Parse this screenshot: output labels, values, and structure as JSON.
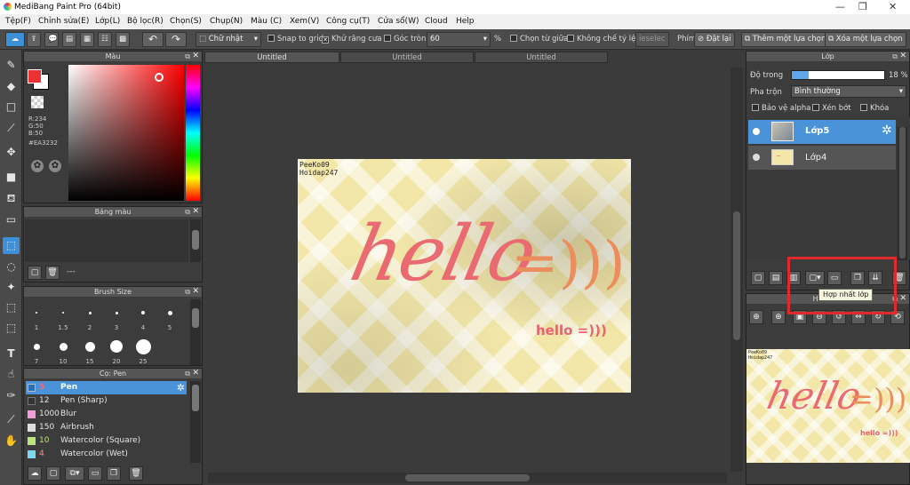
{
  "window": {
    "title": "MediBang Paint Pro (64bit)"
  },
  "menu": [
    "Tệp(F)",
    "Chỉnh sửa(E)",
    "Lớp(L)",
    "Bộ lọc(R)",
    "Chọn(S)",
    "Chụp(N)",
    "Màu (C)",
    "Xem(V)",
    "Công cụ(T)",
    "Cửa sổ(W)",
    "Cloud",
    "Help"
  ],
  "toolbar": {
    "shape": "Chữ nhật",
    "snap_to_grid": "Snap to grid",
    "antialias": "Khử răng cưa",
    "round_corner": "Góc tròn",
    "round_value": "60",
    "percent": "%",
    "select_center": "Chọn từ giữa",
    "no_ratio": "Không chế tỷ lệ",
    "ratio_value": "ieselec",
    "shortcut": "Phím",
    "reset": "Đặt lại",
    "add_selection": "Thêm một lựa chọn",
    "remove_selection": "Xóa một lựa chọn"
  },
  "color_panel": {
    "title": "Màu",
    "r": "R:234",
    "g": "G:50",
    "b": "B:50",
    "hex": "#EA3232",
    "primary": "#EA3232"
  },
  "palette_panel": {
    "title": "Bảng màu",
    "footer": "---"
  },
  "brush_size_panel": {
    "title": "Brush Size",
    "labels_row1": [
      "1",
      "1.5",
      "2",
      "3",
      "4",
      "5"
    ],
    "labels_row2": [
      "7",
      "10",
      "15",
      "20",
      "25"
    ]
  },
  "pen_panel": {
    "title": "Cọ: Pen",
    "items": [
      {
        "size": "5",
        "name": "Pen",
        "color": "#2d6fb0"
      },
      {
        "size": "12",
        "name": "Pen (Sharp)",
        "color": "#333333"
      },
      {
        "size": "1000",
        "name": "Blur",
        "color": "#f39ed9"
      },
      {
        "size": "150",
        "name": "Airbrush",
        "color": "#dddddd"
      },
      {
        "size": "10",
        "name": "Watercolor (Square)",
        "color": "#b9e57a"
      },
      {
        "size": "4",
        "name": "Watercolor (Wet)",
        "color": "#7fd6f0"
      }
    ]
  },
  "tabs": [
    "Untitled",
    "Untitled",
    "Untitled"
  ],
  "canvas": {
    "watermark_line1": "PeeKo09",
    "watermark_line2": "Hoidap247",
    "main_text": "hello",
    "sub_text": "hello =)))",
    "deco": "=)))"
  },
  "layer_panel": {
    "title": "Lớp",
    "opacity_label": "Độ trong",
    "opacity_value": "18 %",
    "opacity": 0.18,
    "blend_label": "Pha trộn",
    "blend_value": "Bình thường",
    "protect_alpha": "Bảo vệ alpha",
    "clipping": "Xén bớt",
    "lock": "Khóa",
    "layers": [
      {
        "name": "Lớp5",
        "selected": true
      },
      {
        "name": "Lớp4",
        "selected": false
      }
    ],
    "tooltip": "Hợp nhất lớp"
  },
  "navigator": {
    "title": "Hoa tiêu"
  }
}
